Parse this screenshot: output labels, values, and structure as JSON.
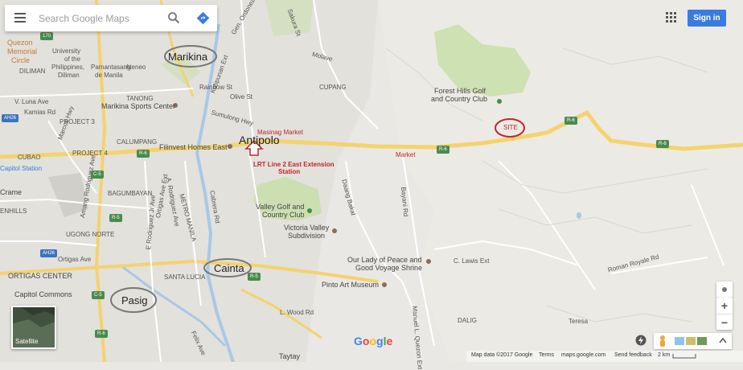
{
  "search": {
    "placeholder": "Search Google Maps"
  },
  "header": {
    "signin_label": "Sign in"
  },
  "map": {
    "highlighted_cities": [
      "Marikina",
      "Cainta",
      "Pasig"
    ],
    "main_city": "Antipolo",
    "annotations": {
      "masinag": "Masinag Market",
      "lrt_line1": "LRT Line 2 East Extension",
      "lrt_line2": "Station",
      "site": "SITE"
    },
    "places": [
      "Quezon",
      "Memorial",
      "Circle",
      "University",
      "of the",
      "Philippines,",
      "Diliman",
      "Pamantasang",
      "Ateneo",
      "de Manila",
      "DILIMAN",
      "V. Luna Ave",
      "Kamias Rd",
      "TANONG",
      "Marikina Sports Center",
      "PROJECT 3",
      "PROJECT 4",
      "CUBAO",
      "Capitol Station",
      "CALUMPANG",
      "Filinvest Homes East",
      "CUPANG",
      "Forest Hills Golf",
      "and Country Club",
      "Market",
      "BAGUMBAYAN",
      "UGONG NORTE",
      "Valley Golf and",
      "Country Club",
      "Victoria Valley",
      "Subdivision",
      "Our Lady of Peace and",
      "Good Voyage Shrine",
      "Pinto Art Museum",
      "ORTIGAS CENTER",
      "SANTA LUCIA",
      "Capitol Commons",
      "Ortigas Ave",
      "DALIG",
      "Teresa",
      "Taytay",
      "Crame",
      "ENHILLS",
      "METRO MANILA",
      "Sumulong Hwy",
      "Rainbow St",
      "Katipunan Ext",
      "C. Lawis Ext",
      "Roman Royale Rd",
      "L. Wood Rd",
      "Manuel L. Quezon Ext",
      "Ortigas Ave Ext",
      "E Rodriguez Jr Ave",
      "Daang Bakal",
      "Gen. Ordonez Ave",
      "Olive St",
      "A. Rodriguez Ave",
      "Amang Rodriguez Ave",
      "Marcos Hwy",
      "Molave",
      "Cabrera Rd",
      "Sakura St",
      "Bayani Rd",
      "Felix Ave"
    ],
    "shields": [
      "170",
      "AH26",
      "R-6",
      "C-5",
      "R-5",
      "AH26",
      "R-6",
      "R-6",
      "R-6",
      "C-5",
      "R-5",
      "R-6"
    ]
  },
  "controls": {
    "satellite_label": "Satellite",
    "zoom_in": "+",
    "zoom_out": "−"
  },
  "footer": {
    "mapdata": "Map data ©2017 Google",
    "terms": "Terms",
    "site": "maps.google.com",
    "feedback": "Send feedback",
    "scale": "2 km"
  },
  "logo": {
    "text": "Google"
  },
  "colors": {
    "land": "#e9e8e4",
    "urban": "#e2e1dc",
    "park": "#c5dfa5",
    "road": "#ffffff",
    "highway": "#f5d26e",
    "river": "#a9c8e6",
    "annotation": "#c0262c",
    "signin": "#3a7be0"
  }
}
